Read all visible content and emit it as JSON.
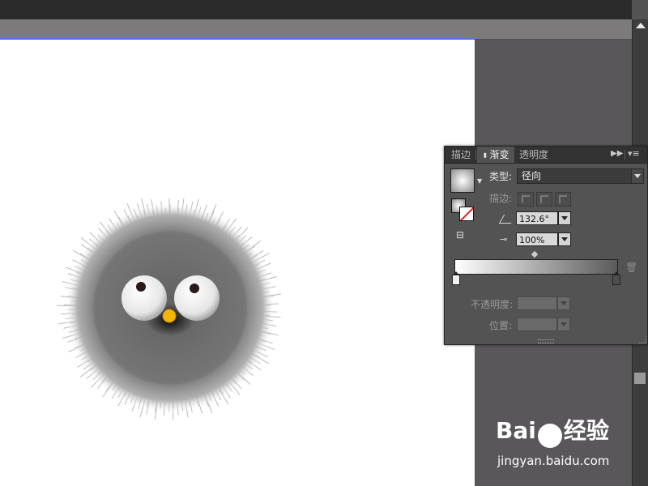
{
  "panel": {
    "tabs": [
      {
        "label": "描边"
      },
      {
        "label": "渐变"
      },
      {
        "label": "透明度"
      }
    ],
    "type_label": "类型:",
    "type_value": "径向",
    "stroke_label": "描边:",
    "angle_value": "132.6°",
    "ratio_value": "100%",
    "opacity_label": "不透明度:",
    "position_label": "位置:",
    "panel_menu_icon": "panel-menu-icon",
    "collapse_icon": "double-arrow-icon"
  },
  "watermark": {
    "brand_left": "Bai",
    "brand_right": "经验",
    "url": "jingyan.baidu.com"
  },
  "colors": {
    "panel_bg": "#535353",
    "tab_bar": "#323232",
    "canvas": "#ffffff",
    "pasteboard": "#5a575a",
    "selection_line": "#4a7bd8",
    "beak": "#f2b705"
  }
}
